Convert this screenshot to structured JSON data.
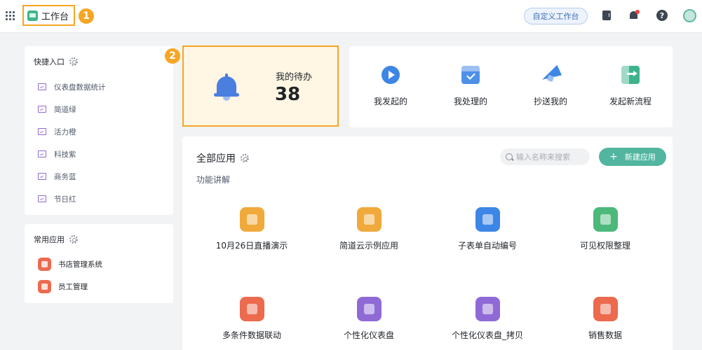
{
  "topbar": {
    "brand": "工作台",
    "badge1": "1",
    "custom_workbench": "自定义工作台",
    "help": "?"
  },
  "quick_entry": {
    "title": "快捷入口",
    "items": [
      {
        "label": "仪表盘数据统计",
        "icon": "monitor-icon"
      },
      {
        "label": "简道绿",
        "icon": "monitor-icon"
      },
      {
        "label": "活力橙",
        "icon": "monitor-icon"
      },
      {
        "label": "科技紫",
        "icon": "monitor-icon"
      },
      {
        "label": "商务蓝",
        "icon": "monitor-icon"
      },
      {
        "label": "节日红",
        "icon": "monitor-icon"
      }
    ]
  },
  "common_apps": {
    "title": "常用应用",
    "items": [
      {
        "label": "书店管理系统",
        "icon": "app-icon"
      },
      {
        "label": "员工管理",
        "icon": "app-icon"
      }
    ]
  },
  "todo": {
    "badge2": "2",
    "label": "我的待办",
    "count": "38"
  },
  "actions": [
    {
      "label": "我发起的",
      "icon": "play-icon"
    },
    {
      "label": "我处理的",
      "icon": "inbox-check-icon"
    },
    {
      "label": "抄送我的",
      "icon": "paper-plane-icon"
    },
    {
      "label": "发起新流程",
      "icon": "exit-arrow-icon"
    }
  ],
  "all_apps": {
    "title": "全部应用",
    "group": "功能讲解",
    "search_placeholder": "输入名称来搜索",
    "new_app": "新建应用",
    "apps": [
      {
        "label": "10月26日直播演示",
        "color": "#f0a93b"
      },
      {
        "label": "简道云示例应用",
        "color": "#f0a93b"
      },
      {
        "label": "子表单自动编号",
        "color": "#3d86e6"
      },
      {
        "label": "可见权限整理",
        "color": "#4cb87a"
      },
      {
        "label": "多条件数据联动",
        "color": "#ec6a4e"
      },
      {
        "label": "个性化仪表盘",
        "color": "#8f6ad6"
      },
      {
        "label": "个性化仪表盘_拷贝",
        "color": "#8f6ad6"
      },
      {
        "label": "销售数据",
        "color": "#ec6a4e"
      }
    ]
  }
}
